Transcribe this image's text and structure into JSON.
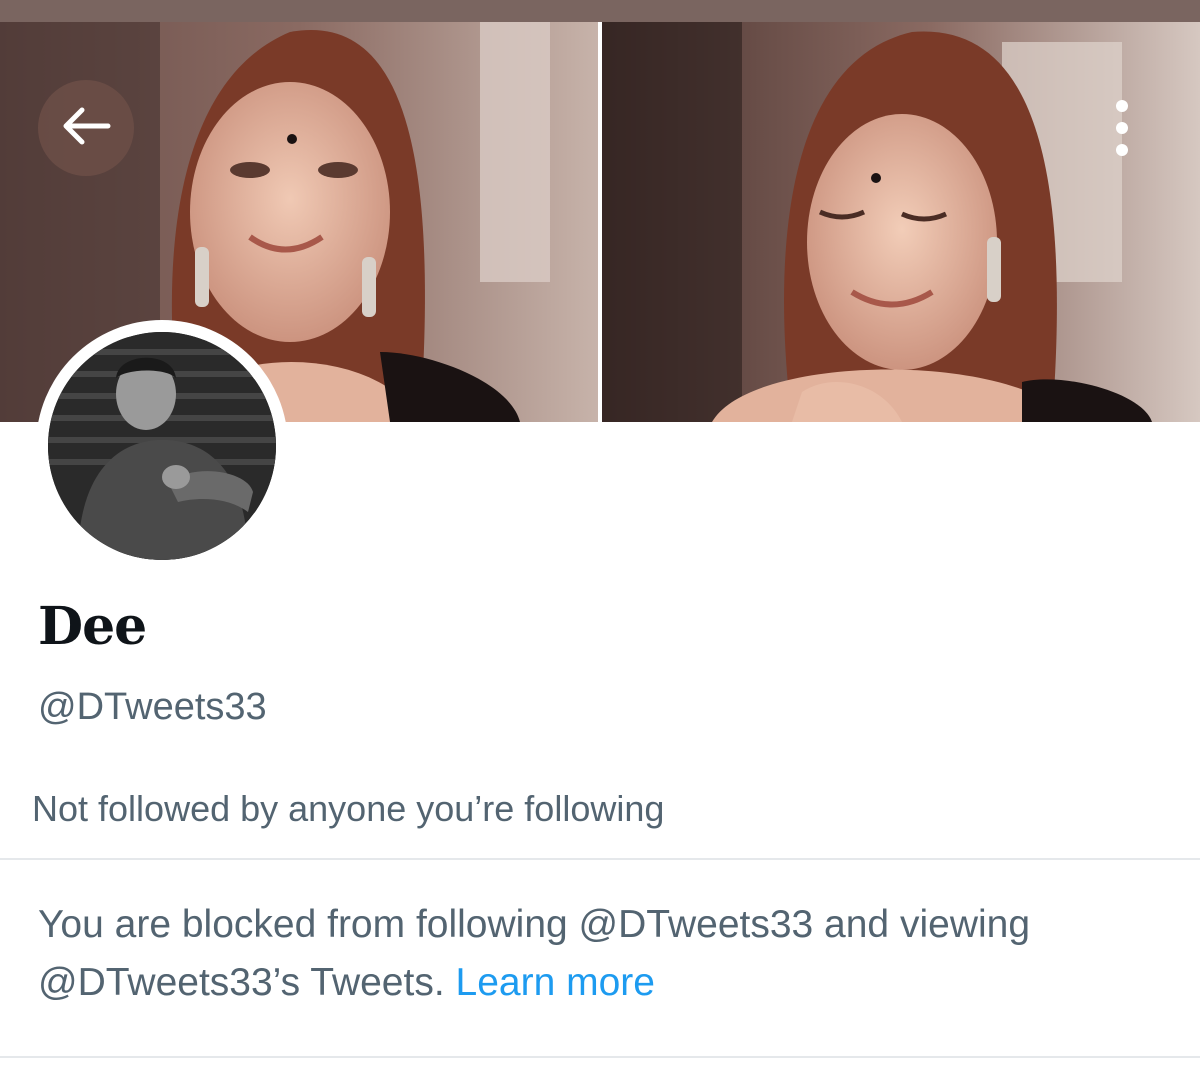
{
  "header": {
    "back_icon": "arrow-left-icon",
    "more_icon": "more-vertical-icon"
  },
  "profile": {
    "display_name": "Dee",
    "handle": "@DTweets33",
    "followed_by": "Not followed by anyone you’re following"
  },
  "blocked_notice": {
    "text": "You are blocked from following @DTweets33 and viewing @DTweets33’s Tweets.",
    "link_label": "Learn more"
  },
  "colors": {
    "secondary_text": "#536471",
    "link": "#1d9bf0",
    "divider": "#e5e8eb"
  }
}
